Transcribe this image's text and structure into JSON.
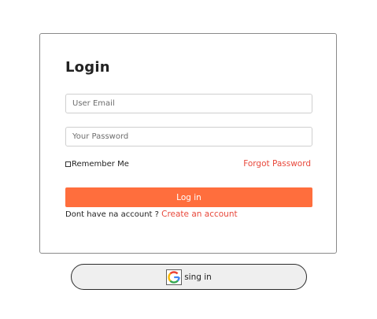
{
  "login": {
    "title": "Login",
    "email_placeholder": "User Email",
    "password_placeholder": "Your Password",
    "remember_label": "Remember Me",
    "forgot_link": "Forgot Password",
    "submit_label": "Log in",
    "no_account_text": "Dont have na account ? ",
    "create_account_link": "Create an account"
  },
  "google": {
    "icon": "google-g-icon",
    "label": "sing in"
  },
  "colors": {
    "accent": "#ff6e3d",
    "link": "#e8483b"
  }
}
